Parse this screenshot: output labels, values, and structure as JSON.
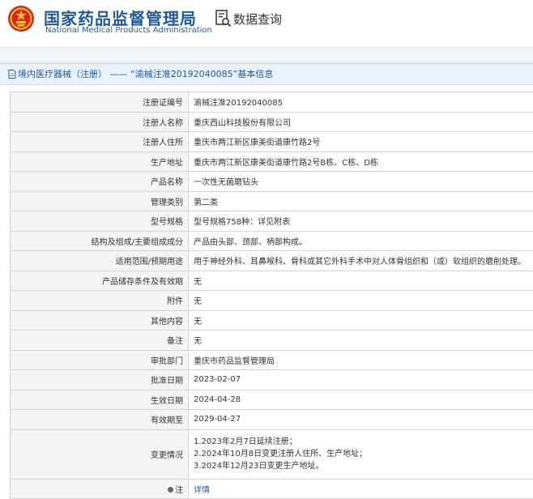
{
  "header": {
    "agency_cn": "国家药品监督管理局",
    "agency_en": "National Medical Products Administration",
    "query_label": "数据查询",
    "emblem_icon": "national-emblem-icon",
    "query_icon": "document-search-icon",
    "brand_color": "#1f5a9e",
    "emblem_color": "#d8261c"
  },
  "breadcrumb": {
    "icon": "page-icon",
    "text": "境内医疗器械（注册） —— “渝械注准20192040085”基本信息"
  },
  "detail": {
    "rows": [
      {
        "label": "注册证编号",
        "value": "渝械注准20192040085"
      },
      {
        "label": "注册人名称",
        "value": "重庆西山科技股份有限公司"
      },
      {
        "label": "注册人住所",
        "value": "重庆市两江新区康美街道康竹路2号"
      },
      {
        "label": "生产地址",
        "value": "重庆市两江新区康美街道康竹路2号B栋、C栋、D栋"
      },
      {
        "label": "产品名称",
        "value": "一次性无菌磨钻头"
      },
      {
        "label": "管理类别",
        "value": "第二类"
      },
      {
        "label": "型号规格",
        "value": "型号规格758种：详见附表"
      },
      {
        "label": "结构及组成/主要组成成分",
        "value": "产品由头部、颈部、柄部构成。"
      },
      {
        "label": "适用范围/预期用途",
        "value": "用于神经外科、耳鼻喉科、骨科或其它外科手术中对人体骨组织和（或）软组织的磨削处理。"
      },
      {
        "label": "产品储存条件及有效期",
        "value": "无"
      },
      {
        "label": "附件",
        "value": "无"
      },
      {
        "label": "其他内容",
        "value": "无"
      },
      {
        "label": "备注",
        "value": "无"
      },
      {
        "label": "审批部门",
        "value": "重庆市药品监督管理局"
      },
      {
        "label": "批准日期",
        "value": "2023-02-07"
      },
      {
        "label": "生效日期",
        "value": "2024-04-28"
      },
      {
        "label": "有效期至",
        "value": "2029-04-27"
      }
    ],
    "change": {
      "label": "变更情况",
      "lines": [
        "1.2023年2月7日延续注册；",
        "2.2024年10月8日变更注册人住所、生产地址；",
        "3.2024年12月23日变更生产地址。"
      ]
    },
    "note": {
      "label": "注",
      "icon": "bullet-icon",
      "link_text": "详情"
    }
  }
}
